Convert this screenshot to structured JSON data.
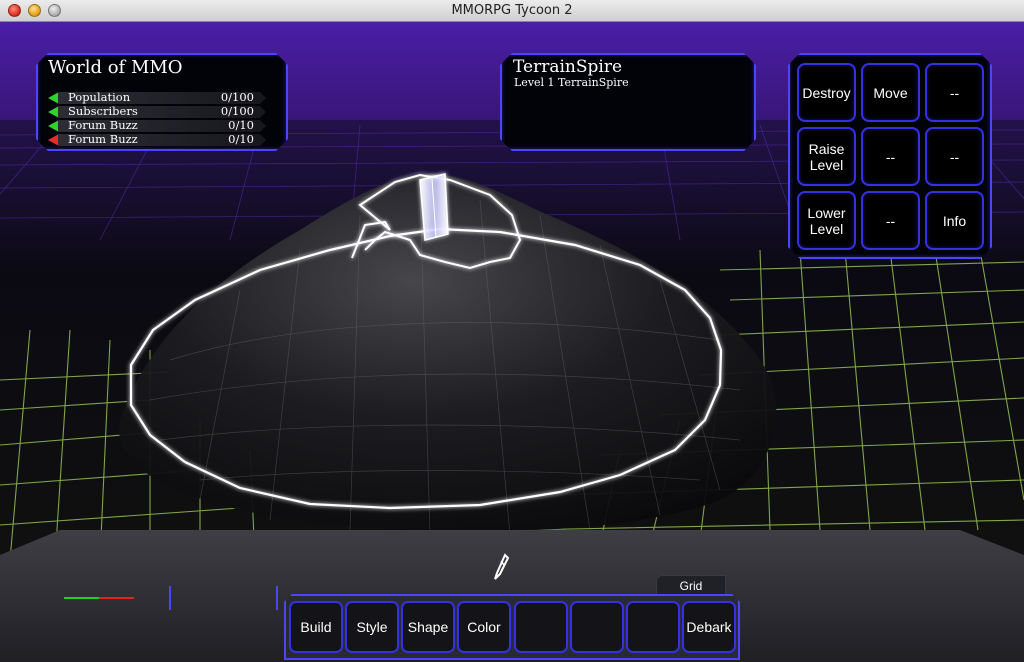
{
  "window": {
    "title": "MMORPG Tycoon 2"
  },
  "world_panel": {
    "title": "World of MMO",
    "stats": [
      {
        "label": "Population",
        "value": "0/100",
        "trend": "up"
      },
      {
        "label": "Subscribers",
        "value": "0/100",
        "trend": "up"
      },
      {
        "label": "Forum Buzz",
        "value": "0/10",
        "trend": "up"
      },
      {
        "label": "Forum Buzz",
        "value": "0/10",
        "trend": "down"
      }
    ]
  },
  "selection_panel": {
    "title": "TerrainSpire",
    "subtitle": "Level 1 TerrainSpire"
  },
  "actions": [
    {
      "label": "Destroy"
    },
    {
      "label": "Move"
    },
    {
      "label": "--"
    },
    {
      "label": "Raise\nLevel"
    },
    {
      "label": "--"
    },
    {
      "label": "--"
    },
    {
      "label": "Lower\nLevel"
    },
    {
      "label": "--"
    },
    {
      "label": "Info"
    }
  ],
  "toolbar": {
    "grid_tab_label": "Grid",
    "buttons": [
      {
        "label": "Build"
      },
      {
        "label": "Style"
      },
      {
        "label": "Shape"
      },
      {
        "label": "Color"
      },
      {
        "label": ""
      },
      {
        "label": ""
      },
      {
        "label": ""
      },
      {
        "label": "Debark"
      }
    ]
  },
  "colors": {
    "accent_blue": "#4b45ff",
    "sky_purple": "#3d1a8e",
    "grid_green": "#b5e85a",
    "trend_up": "#2fd22f",
    "trend_down": "#e82b2b"
  }
}
